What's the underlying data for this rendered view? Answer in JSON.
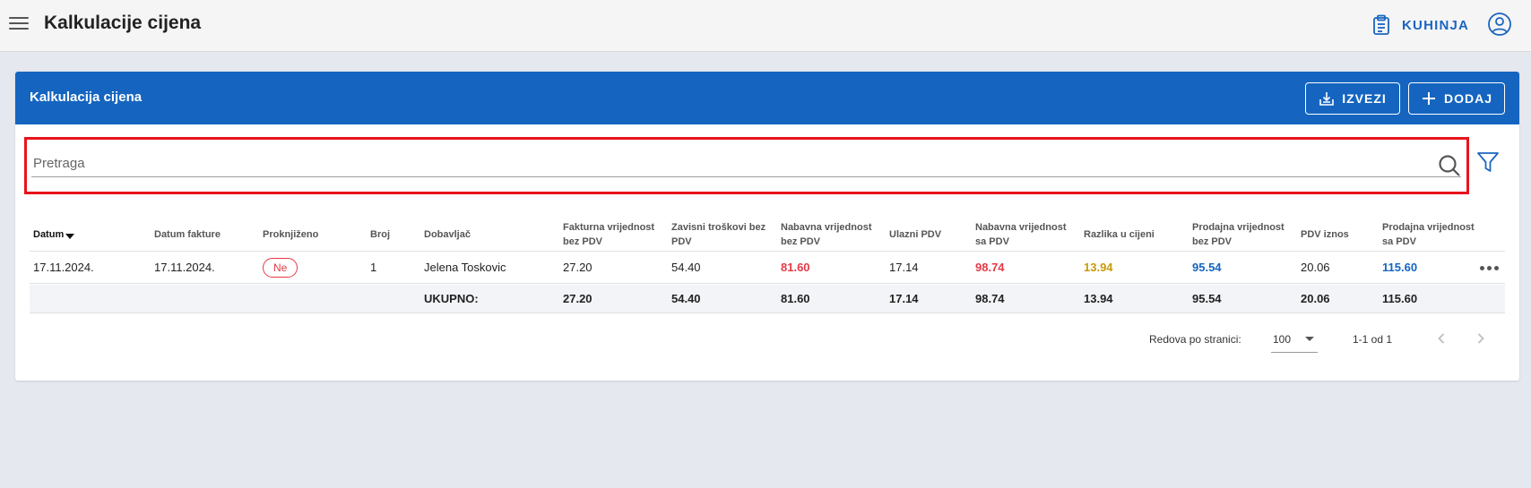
{
  "topbar": {
    "title": "Kalkulacije cijena",
    "kitchen_label": "KUHINJA",
    "icons": [
      "menu-icon",
      "clipboard-icon",
      "user-icon"
    ]
  },
  "card": {
    "title": "Kalkulacija cijena",
    "export_label": "IZVEZI",
    "add_label": "DODAJ"
  },
  "search": {
    "placeholder": "Pretraga",
    "value": ""
  },
  "table": {
    "columns": [
      "Datum",
      "Datum fakture",
      "Proknjiženo",
      "Broj",
      "Dobavljač",
      "Fakturna vrijednost bez PDV",
      "Zavisni troškovi bez PDV",
      "Nabavna vrijednost bez PDV",
      "Ulazni PDV",
      "Nabavna vrijednost sa PDV",
      "Razlika u cijeni",
      "Prodajna vrijednost bez PDV",
      "PDV iznos",
      "Prodajna vrijednost sa PDV"
    ],
    "rows": [
      {
        "datum": "17.11.2024.",
        "datum_fakture": "17.11.2024.",
        "proknjizeno": "Ne",
        "broj": "1",
        "dobavljac": "Jelena Toskovic",
        "fakturna": "27.20",
        "zavisni": "54.40",
        "nabavna_bez": "81.60",
        "ulazni_pdv": "17.14",
        "nabavna_sa": "98.74",
        "razlika": "13.94",
        "prodajna_bez": "95.54",
        "pdv_iznos": "20.06",
        "prodajna_sa": "115.60"
      }
    ],
    "total": {
      "label": "UKUPNO:",
      "fakturna": "27.20",
      "zavisni": "54.40",
      "nabavna_bez": "81.60",
      "ulazni_pdv": "17.14",
      "nabavna_sa": "98.74",
      "razlika": "13.94",
      "prodajna_bez": "95.54",
      "pdv_iznos": "20.06",
      "prodajna_sa": "115.60"
    }
  },
  "pagination": {
    "rows_label": "Redova po stranici:",
    "rows_value": "100",
    "range": "1-1 od 1"
  },
  "colors": {
    "primary": "#1565c0",
    "danger": "#e53945",
    "warning": "#c99a06",
    "highlight_border": "#e8141b"
  }
}
